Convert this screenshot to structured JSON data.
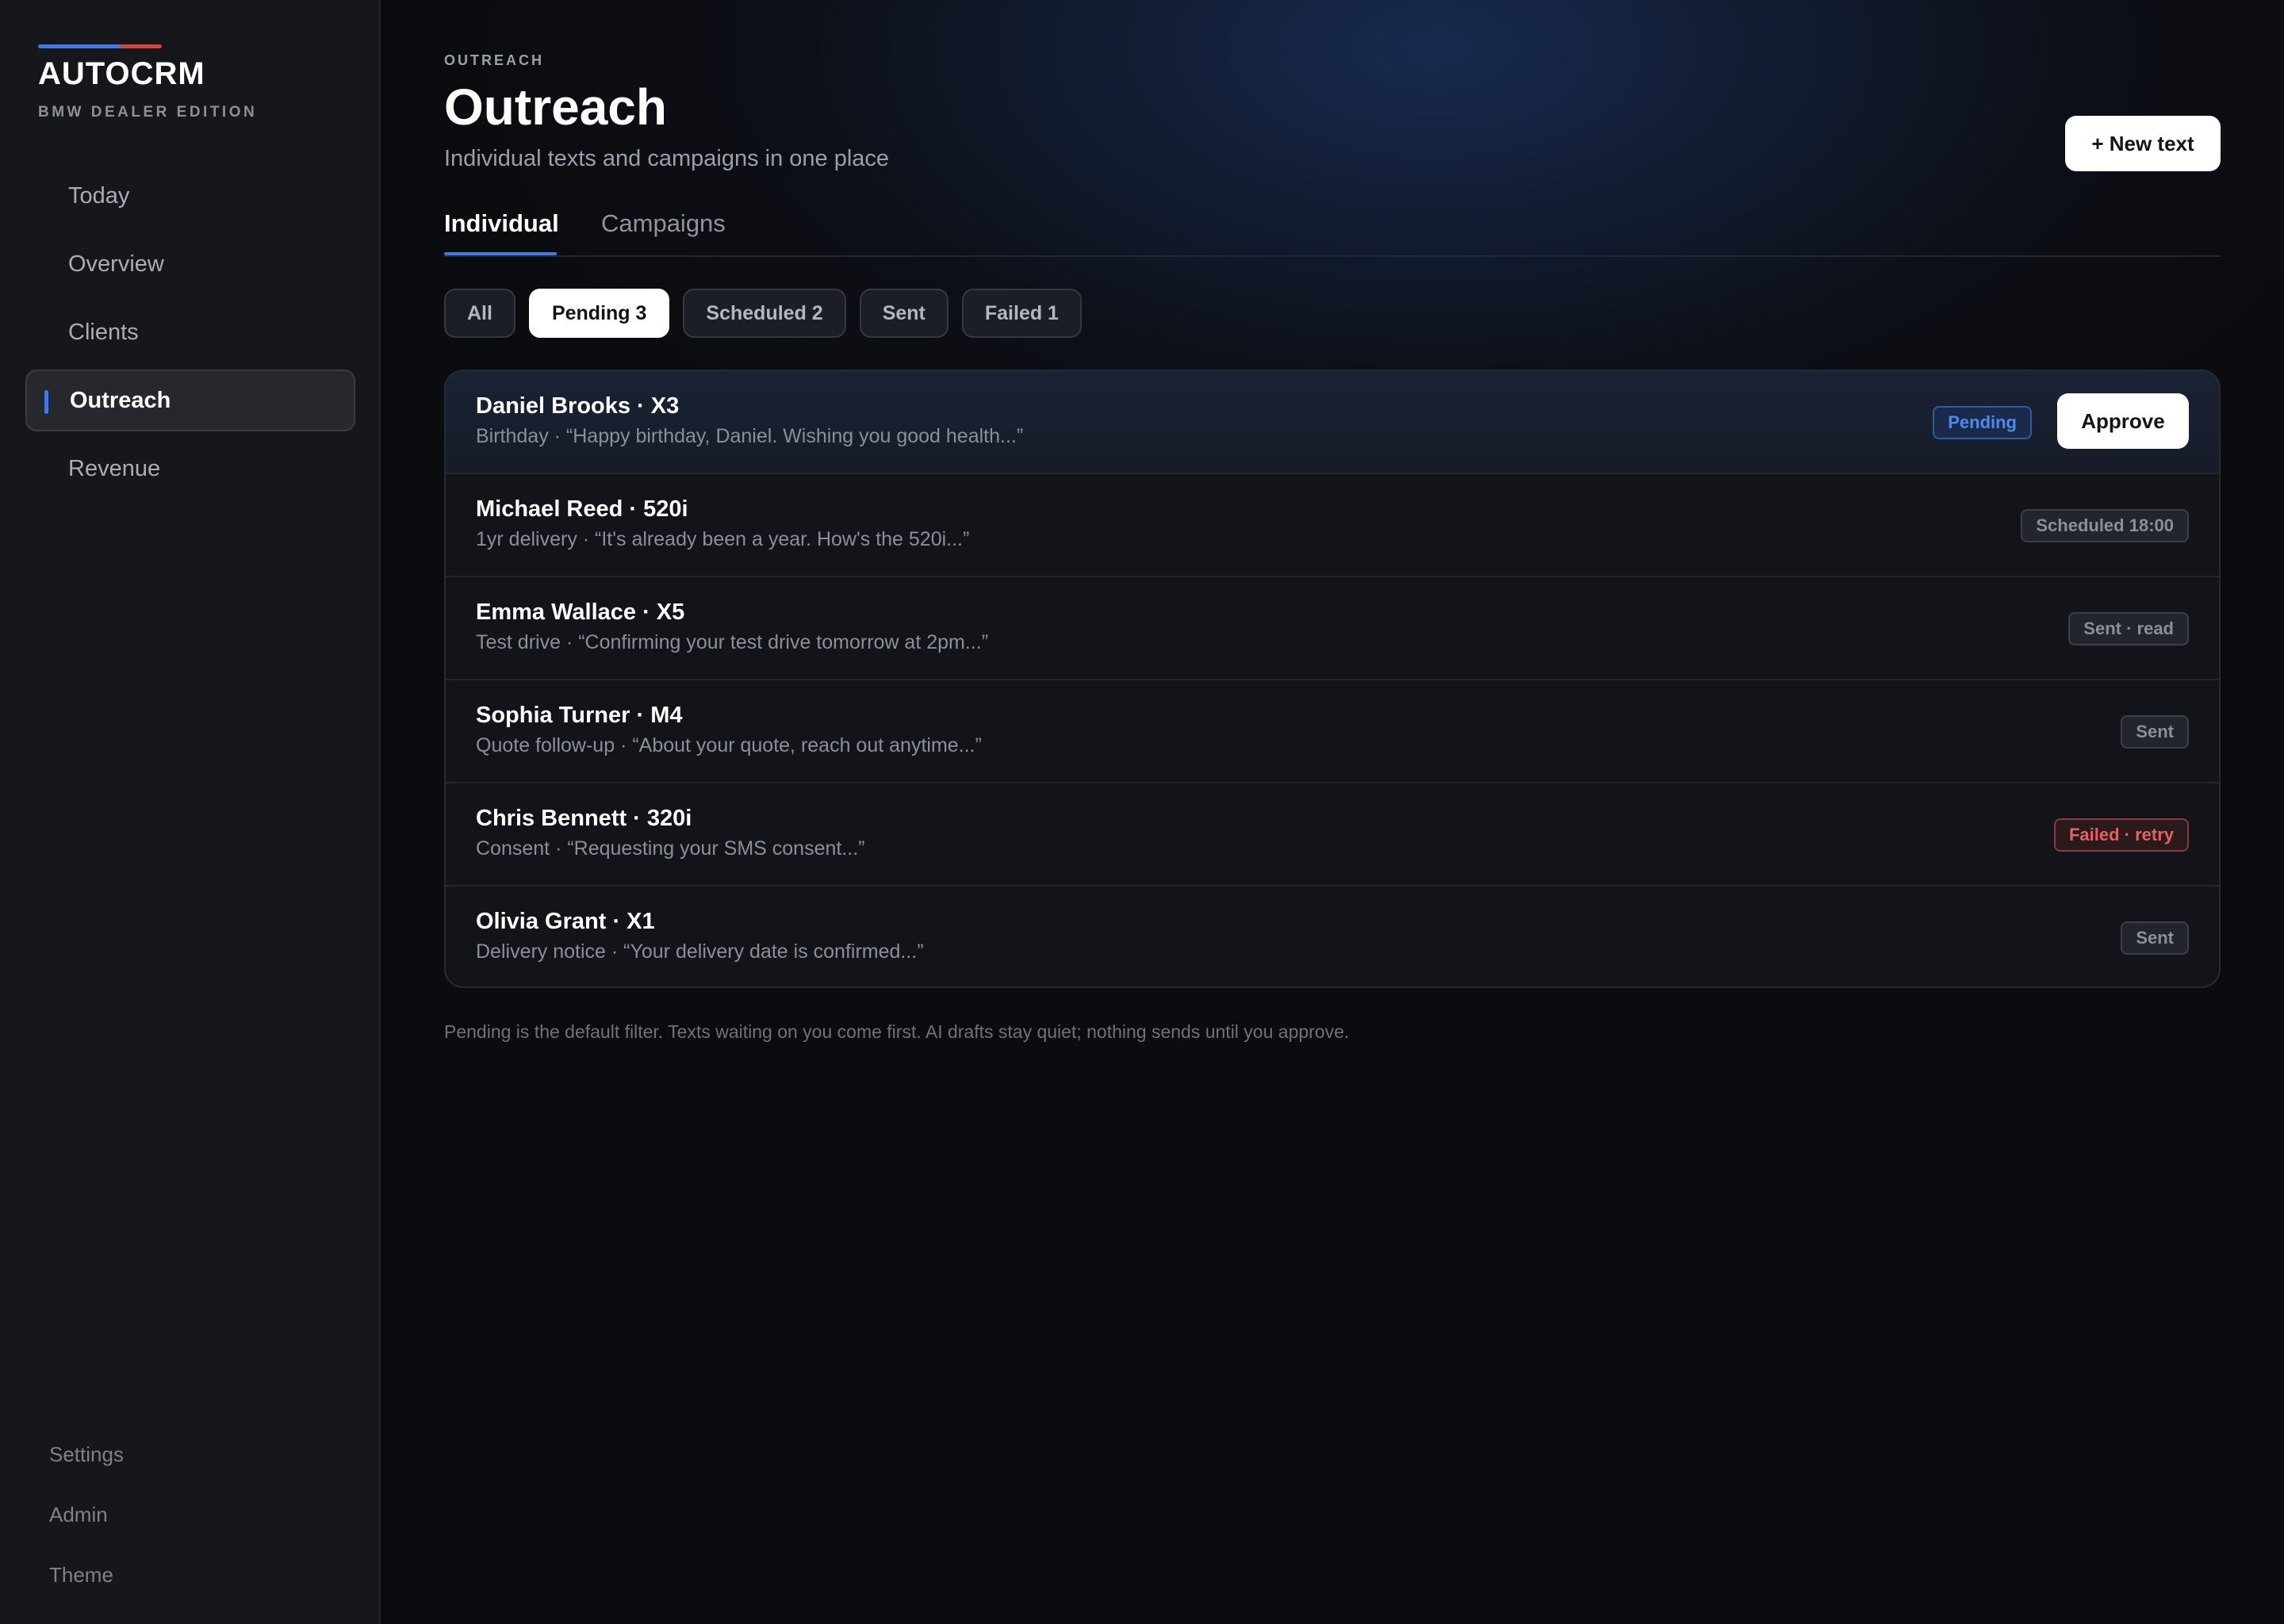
{
  "colors": {
    "accent_blue": "#3f7ae6",
    "accent_red": "#d2443c",
    "pending": "#4b8bf0",
    "failed": "#e06262"
  },
  "brand": {
    "title": "AUTOCRM",
    "subtitle": "BMW DEALER EDITION"
  },
  "sidebar": {
    "items": [
      {
        "label": "Today"
      },
      {
        "label": "Overview"
      },
      {
        "label": "Clients"
      },
      {
        "label": "Outreach",
        "active": true
      },
      {
        "label": "Revenue"
      }
    ],
    "bottom": [
      {
        "label": "Settings"
      },
      {
        "label": "Admin"
      },
      {
        "label": "Theme"
      }
    ]
  },
  "header": {
    "eyebrow": "OUTREACH",
    "title": "Outreach",
    "subtitle": "Individual texts and campaigns in one place",
    "new_button": "+ New text"
  },
  "tabs": [
    {
      "label": "Individual",
      "active": true
    },
    {
      "label": "Campaigns"
    }
  ],
  "filters": [
    {
      "label": "All"
    },
    {
      "label": "Pending 3",
      "active": true
    },
    {
      "label": "Scheduled 2"
    },
    {
      "label": "Sent"
    },
    {
      "label": "Failed 1"
    }
  ],
  "messages": [
    {
      "title": "Daniel Brooks · X3",
      "description": "Birthday · “Happy birthday, Daniel. Wishing you good health...”",
      "status": "Pending",
      "action": "Approve"
    },
    {
      "title": "Michael Reed · 520i",
      "description": "1yr delivery · “It's already been a year. How's the 520i...”",
      "status": "Scheduled 18:00"
    },
    {
      "title": "Emma Wallace · X5",
      "description": "Test drive · “Confirming your test drive tomorrow at 2pm...”",
      "status": "Sent · read"
    },
    {
      "title": "Sophia Turner · M4",
      "description": "Quote follow-up · “About your quote, reach out anytime...”",
      "status": "Sent"
    },
    {
      "title": "Chris Bennett · 320i",
      "description": "Consent · “Requesting your SMS consent...”",
      "status": "Failed · retry"
    },
    {
      "title": "Olivia Grant · X1",
      "description": "Delivery notice · “Your delivery date is confirmed...”",
      "status": "Sent"
    }
  ],
  "footnote": "Pending is the default filter. Texts waiting on you come first. AI drafts stay quiet; nothing sends until you approve."
}
